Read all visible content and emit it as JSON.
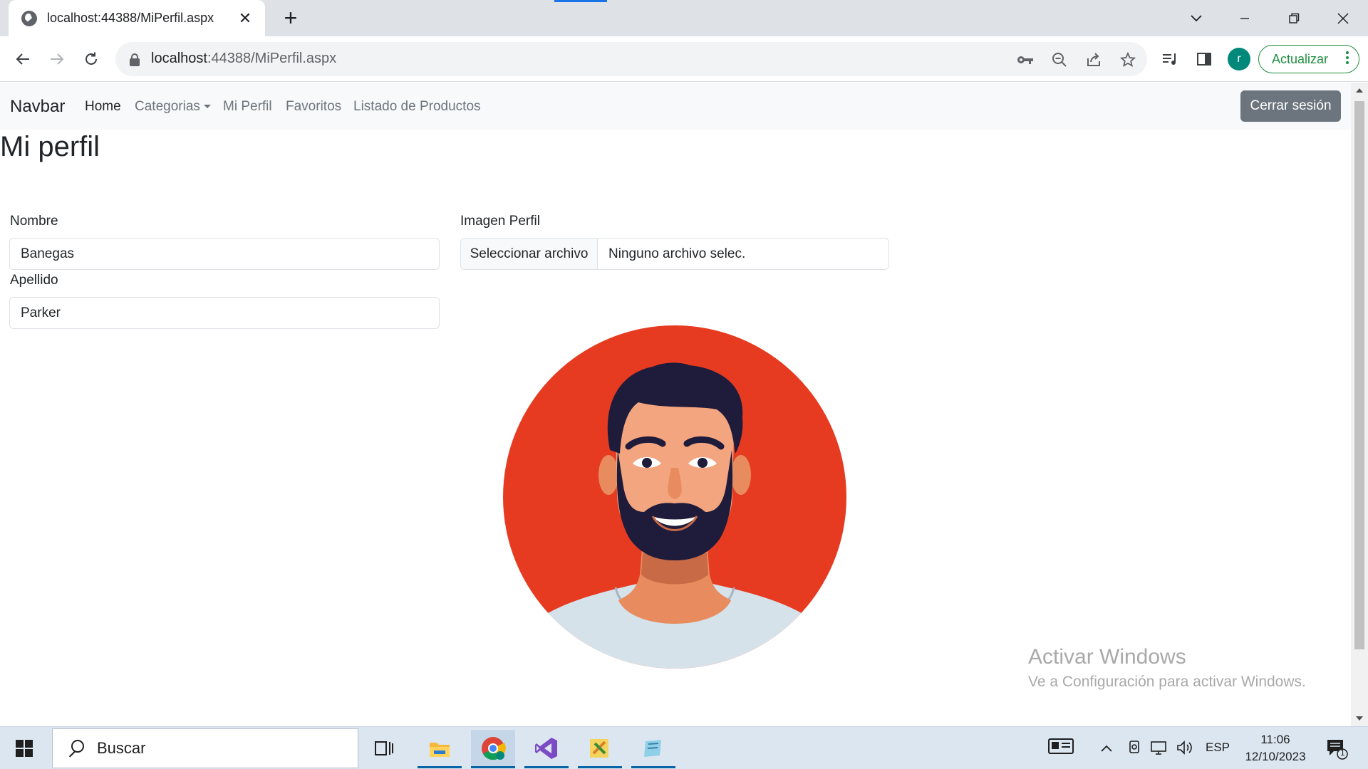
{
  "browser": {
    "tab_title": "localhost:44388/MiPerfil.aspx",
    "url_host": "localhost",
    "url_path": ":44388/MiPerfil.aspx",
    "profile_initial": "r",
    "update_label": "Actualizar"
  },
  "navbar": {
    "brand": "Navbar",
    "links": [
      "Home",
      "Categorias",
      "Mi Perfil",
      "Favoritos",
      "Listado de Productos"
    ],
    "logout_label": "Cerrar sesión"
  },
  "page": {
    "title": "Mi perfil",
    "nombre_label": "Nombre",
    "nombre_value": "Banegas",
    "apellido_label": "Apellido",
    "apellido_value": "Parker",
    "imagen_label": "Imagen Perfil",
    "file_button": "Seleccionar archivo",
    "file_status": "Ninguno archivo selec."
  },
  "watermark": {
    "title": "Activar Windows",
    "subtitle": "Ve a Configuración para activar Windows."
  },
  "taskbar": {
    "search_placeholder": "Buscar",
    "language": "ESP",
    "time": "11:06",
    "date": "12/10/2023",
    "notification_count": "1"
  },
  "colors": {
    "avatar_bg": "#e63b21",
    "hair": "#1f1b3a",
    "skin": "#f2a57f",
    "shirt": "#d6e2ea",
    "logout_bg": "#6c757d"
  }
}
